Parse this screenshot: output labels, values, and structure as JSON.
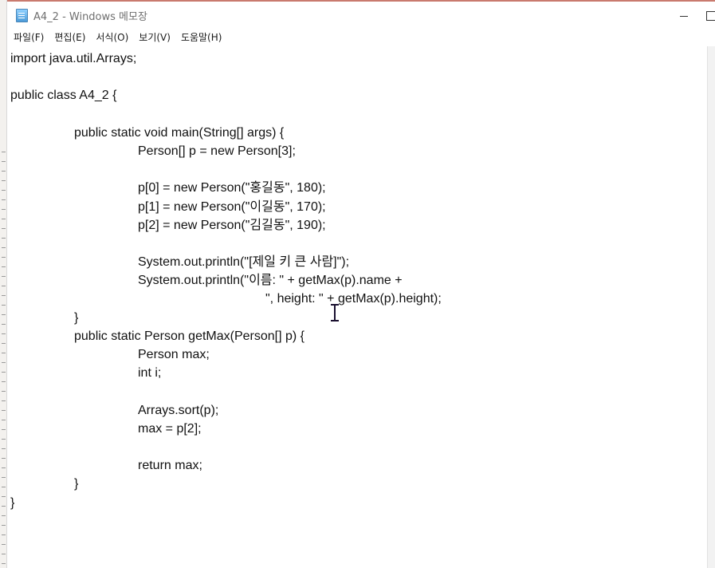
{
  "window": {
    "title": "A4_2 - Windows 메모장"
  },
  "menubar": {
    "items": [
      "파일(F)",
      "편집(E)",
      "서식(O)",
      "보기(V)",
      "도움말(H)"
    ]
  },
  "editor": {
    "lines": [
      "import java.util.Arrays;",
      "",
      "public class A4_2 {",
      "",
      "\t\tpublic static void main(String[] args) {",
      "\t\t\t\tPerson[] p = new Person[3];",
      "",
      "\t\t\t\tp[0] = new Person(\"홍길동\", 180);",
      "\t\t\t\tp[1] = new Person(\"이길동\", 170);",
      "\t\t\t\tp[2] = new Person(\"김길동\", 190);",
      "",
      "\t\t\t\tSystem.out.println(\"[제일 키 큰 사람]\");",
      "\t\t\t\tSystem.out.println(\"이름: \" + getMax(p).name +",
      "\t\t\t\t\t\t\t\t\", height: \" + getMax(p).height);",
      "\t\t}",
      "\t\tpublic static Person getMax(Person[] p) {",
      "\t\t\t\tPerson max;",
      "\t\t\t\tint i;",
      "",
      "\t\t\t\tArrays.sort(p);",
      "\t\t\t\tmax = p[2];",
      "",
      "\t\t\t\treturn max;",
      "\t\t}",
      "}"
    ]
  },
  "icons": {
    "app": "notepad-icon",
    "minimize": "minimize-icon",
    "maximize": "maximize-icon",
    "cursor": "text-cursor-icon"
  },
  "colors": {
    "text": "#111111",
    "title_text": "#6f6f6f",
    "background": "#ffffff"
  }
}
